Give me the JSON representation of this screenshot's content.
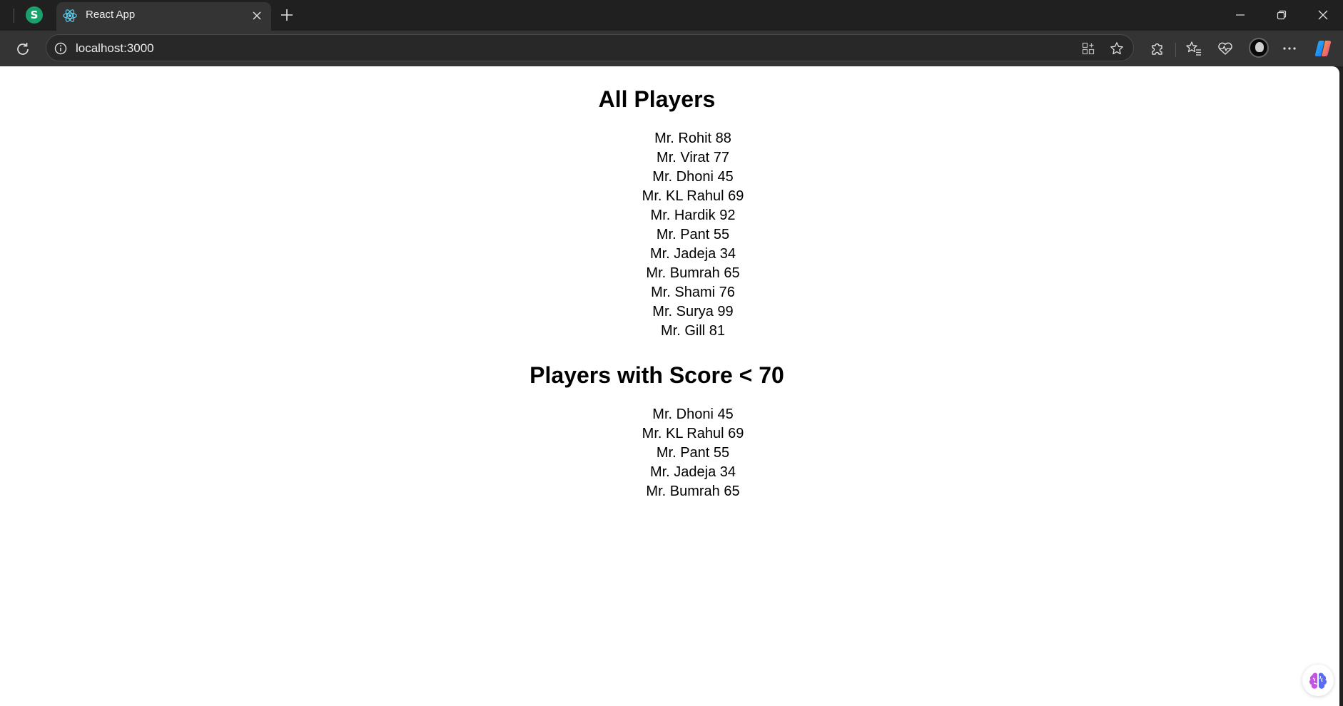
{
  "browser": {
    "pinned_tab_letter": "S",
    "active_tab_title": "React App",
    "address": "localhost:3000",
    "colors": {
      "frame": "#202020",
      "toolbar": "#343434",
      "pinned_tab": "#1aa06d",
      "react_logo": "#61dafb"
    }
  },
  "icons": {
    "tab_favicon": "react-logo-icon",
    "close_tab": "close-icon",
    "new_tab": "plus-icon",
    "minimize": "minimize-icon",
    "restore": "restore-icon",
    "close_window": "close-icon",
    "reload": "reload-icon",
    "site_info": "info-icon",
    "app_available": "app-grid-icon",
    "favorite": "star-icon",
    "extensions": "puzzle-icon",
    "favorites": "favorites-icon",
    "browser_essentials": "heart-pulse-icon",
    "settings_more": "more-icon",
    "copilot": "copilot-icon",
    "floating": "brain-icon"
  },
  "page": {
    "all_title": "All Players",
    "all_players": [
      "Mr. Rohit 88",
      "Mr. Virat 77",
      "Mr. Dhoni 45",
      "Mr. KL Rahul 69",
      "Mr. Hardik 92",
      "Mr. Pant 55",
      "Mr. Jadeja 34",
      "Mr. Bumrah 65",
      "Mr. Shami 76",
      "Mr. Surya 99",
      "Mr. Gill 81"
    ],
    "low_title": "Players with Score < 70",
    "low_players": [
      "Mr. Dhoni 45",
      "Mr. KL Rahul 69",
      "Mr. Pant 55",
      "Mr. Jadeja 34",
      "Mr. Bumrah 65"
    ]
  }
}
